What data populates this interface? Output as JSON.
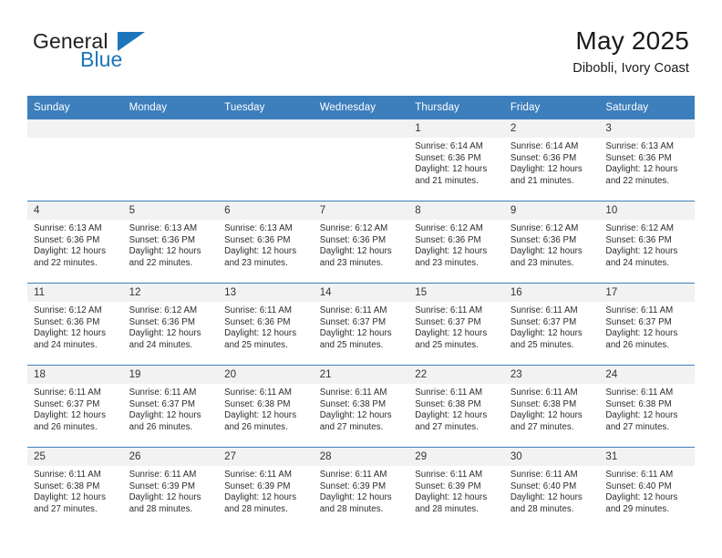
{
  "brand": {
    "name_top": "General",
    "name_bottom": "Blue",
    "accent_color": "#1b75bb"
  },
  "header": {
    "title": "May 2025",
    "subtitle": "Dibobli, Ivory Coast"
  },
  "theme": {
    "header_band": "#3d7ebc",
    "daynum_band": "#f2f2f2",
    "text": "#2b2b2b"
  },
  "weekdays": [
    "Sunday",
    "Monday",
    "Tuesday",
    "Wednesday",
    "Thursday",
    "Friday",
    "Saturday"
  ],
  "weeks": [
    [
      {
        "day": "",
        "blank": true
      },
      {
        "day": "",
        "blank": true
      },
      {
        "day": "",
        "blank": true
      },
      {
        "day": "",
        "blank": true
      },
      {
        "day": "1",
        "sunrise": "Sunrise: 6:14 AM",
        "sunset": "Sunset: 6:36 PM",
        "daylight1": "Daylight: 12 hours",
        "daylight2": "and 21 minutes."
      },
      {
        "day": "2",
        "sunrise": "Sunrise: 6:14 AM",
        "sunset": "Sunset: 6:36 PM",
        "daylight1": "Daylight: 12 hours",
        "daylight2": "and 21 minutes."
      },
      {
        "day": "3",
        "sunrise": "Sunrise: 6:13 AM",
        "sunset": "Sunset: 6:36 PM",
        "daylight1": "Daylight: 12 hours",
        "daylight2": "and 22 minutes."
      }
    ],
    [
      {
        "day": "4",
        "sunrise": "Sunrise: 6:13 AM",
        "sunset": "Sunset: 6:36 PM",
        "daylight1": "Daylight: 12 hours",
        "daylight2": "and 22 minutes."
      },
      {
        "day": "5",
        "sunrise": "Sunrise: 6:13 AM",
        "sunset": "Sunset: 6:36 PM",
        "daylight1": "Daylight: 12 hours",
        "daylight2": "and 22 minutes."
      },
      {
        "day": "6",
        "sunrise": "Sunrise: 6:13 AM",
        "sunset": "Sunset: 6:36 PM",
        "daylight1": "Daylight: 12 hours",
        "daylight2": "and 23 minutes."
      },
      {
        "day": "7",
        "sunrise": "Sunrise: 6:12 AM",
        "sunset": "Sunset: 6:36 PM",
        "daylight1": "Daylight: 12 hours",
        "daylight2": "and 23 minutes."
      },
      {
        "day": "8",
        "sunrise": "Sunrise: 6:12 AM",
        "sunset": "Sunset: 6:36 PM",
        "daylight1": "Daylight: 12 hours",
        "daylight2": "and 23 minutes."
      },
      {
        "day": "9",
        "sunrise": "Sunrise: 6:12 AM",
        "sunset": "Sunset: 6:36 PM",
        "daylight1": "Daylight: 12 hours",
        "daylight2": "and 23 minutes."
      },
      {
        "day": "10",
        "sunrise": "Sunrise: 6:12 AM",
        "sunset": "Sunset: 6:36 PM",
        "daylight1": "Daylight: 12 hours",
        "daylight2": "and 24 minutes."
      }
    ],
    [
      {
        "day": "11",
        "sunrise": "Sunrise: 6:12 AM",
        "sunset": "Sunset: 6:36 PM",
        "daylight1": "Daylight: 12 hours",
        "daylight2": "and 24 minutes."
      },
      {
        "day": "12",
        "sunrise": "Sunrise: 6:12 AM",
        "sunset": "Sunset: 6:36 PM",
        "daylight1": "Daylight: 12 hours",
        "daylight2": "and 24 minutes."
      },
      {
        "day": "13",
        "sunrise": "Sunrise: 6:11 AM",
        "sunset": "Sunset: 6:36 PM",
        "daylight1": "Daylight: 12 hours",
        "daylight2": "and 25 minutes."
      },
      {
        "day": "14",
        "sunrise": "Sunrise: 6:11 AM",
        "sunset": "Sunset: 6:37 PM",
        "daylight1": "Daylight: 12 hours",
        "daylight2": "and 25 minutes."
      },
      {
        "day": "15",
        "sunrise": "Sunrise: 6:11 AM",
        "sunset": "Sunset: 6:37 PM",
        "daylight1": "Daylight: 12 hours",
        "daylight2": "and 25 minutes."
      },
      {
        "day": "16",
        "sunrise": "Sunrise: 6:11 AM",
        "sunset": "Sunset: 6:37 PM",
        "daylight1": "Daylight: 12 hours",
        "daylight2": "and 25 minutes."
      },
      {
        "day": "17",
        "sunrise": "Sunrise: 6:11 AM",
        "sunset": "Sunset: 6:37 PM",
        "daylight1": "Daylight: 12 hours",
        "daylight2": "and 26 minutes."
      }
    ],
    [
      {
        "day": "18",
        "sunrise": "Sunrise: 6:11 AM",
        "sunset": "Sunset: 6:37 PM",
        "daylight1": "Daylight: 12 hours",
        "daylight2": "and 26 minutes."
      },
      {
        "day": "19",
        "sunrise": "Sunrise: 6:11 AM",
        "sunset": "Sunset: 6:37 PM",
        "daylight1": "Daylight: 12 hours",
        "daylight2": "and 26 minutes."
      },
      {
        "day": "20",
        "sunrise": "Sunrise: 6:11 AM",
        "sunset": "Sunset: 6:38 PM",
        "daylight1": "Daylight: 12 hours",
        "daylight2": "and 26 minutes."
      },
      {
        "day": "21",
        "sunrise": "Sunrise: 6:11 AM",
        "sunset": "Sunset: 6:38 PM",
        "daylight1": "Daylight: 12 hours",
        "daylight2": "and 27 minutes."
      },
      {
        "day": "22",
        "sunrise": "Sunrise: 6:11 AM",
        "sunset": "Sunset: 6:38 PM",
        "daylight1": "Daylight: 12 hours",
        "daylight2": "and 27 minutes."
      },
      {
        "day": "23",
        "sunrise": "Sunrise: 6:11 AM",
        "sunset": "Sunset: 6:38 PM",
        "daylight1": "Daylight: 12 hours",
        "daylight2": "and 27 minutes."
      },
      {
        "day": "24",
        "sunrise": "Sunrise: 6:11 AM",
        "sunset": "Sunset: 6:38 PM",
        "daylight1": "Daylight: 12 hours",
        "daylight2": "and 27 minutes."
      }
    ],
    [
      {
        "day": "25",
        "sunrise": "Sunrise: 6:11 AM",
        "sunset": "Sunset: 6:38 PM",
        "daylight1": "Daylight: 12 hours",
        "daylight2": "and 27 minutes."
      },
      {
        "day": "26",
        "sunrise": "Sunrise: 6:11 AM",
        "sunset": "Sunset: 6:39 PM",
        "daylight1": "Daylight: 12 hours",
        "daylight2": "and 28 minutes."
      },
      {
        "day": "27",
        "sunrise": "Sunrise: 6:11 AM",
        "sunset": "Sunset: 6:39 PM",
        "daylight1": "Daylight: 12 hours",
        "daylight2": "and 28 minutes."
      },
      {
        "day": "28",
        "sunrise": "Sunrise: 6:11 AM",
        "sunset": "Sunset: 6:39 PM",
        "daylight1": "Daylight: 12 hours",
        "daylight2": "and 28 minutes."
      },
      {
        "day": "29",
        "sunrise": "Sunrise: 6:11 AM",
        "sunset": "Sunset: 6:39 PM",
        "daylight1": "Daylight: 12 hours",
        "daylight2": "and 28 minutes."
      },
      {
        "day": "30",
        "sunrise": "Sunrise: 6:11 AM",
        "sunset": "Sunset: 6:40 PM",
        "daylight1": "Daylight: 12 hours",
        "daylight2": "and 28 minutes."
      },
      {
        "day": "31",
        "sunrise": "Sunrise: 6:11 AM",
        "sunset": "Sunset: 6:40 PM",
        "daylight1": "Daylight: 12 hours",
        "daylight2": "and 29 minutes."
      }
    ]
  ]
}
